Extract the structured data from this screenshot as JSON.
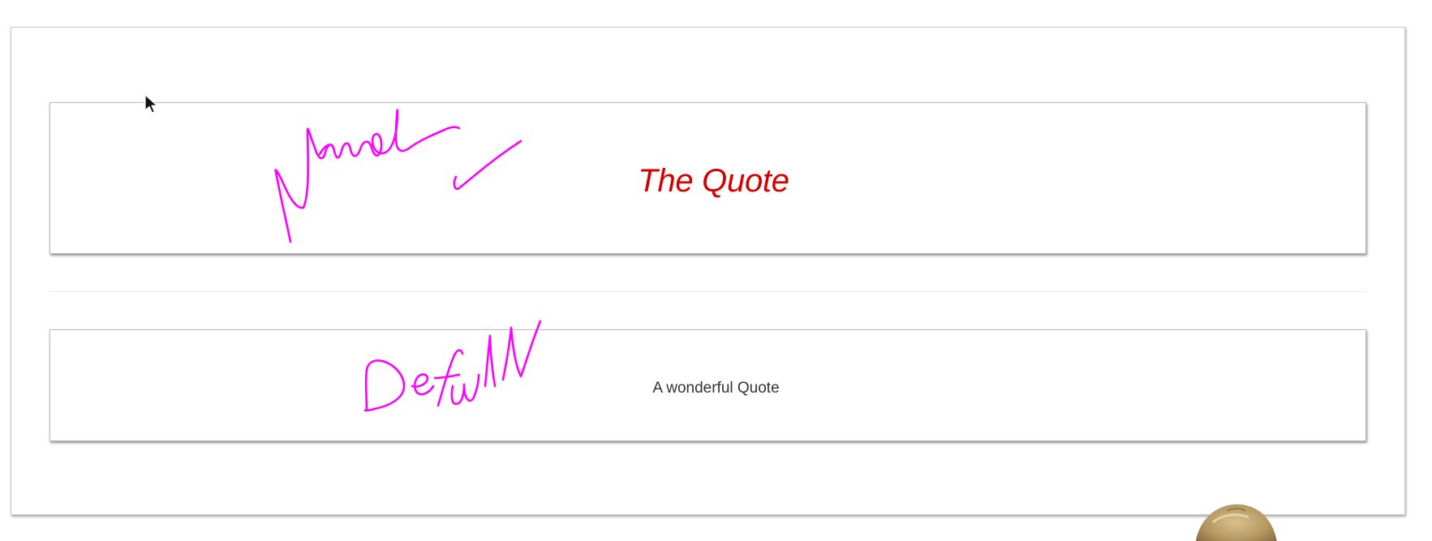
{
  "named_quote": {
    "text": "The Quote",
    "color": "#d40000"
  },
  "default_quote": {
    "text": "A wonderful Quote",
    "color": "#333333"
  },
  "annotations": {
    "ink_color": "#ff00ff",
    "named_label": "Named",
    "default_label": "Default"
  },
  "icons": {
    "cursor": "mouse-pointer-icon",
    "checkmark": "checkmark-icon"
  }
}
